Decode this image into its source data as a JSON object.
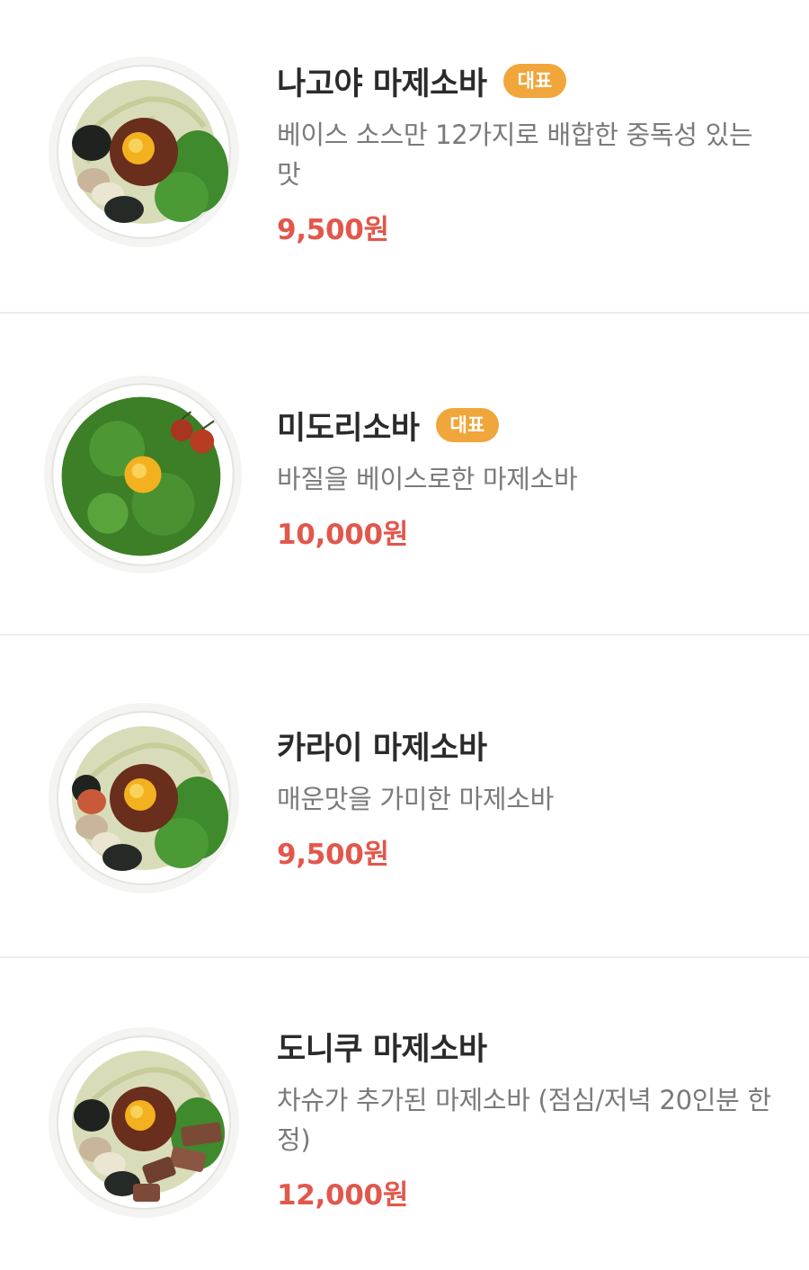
{
  "menu": {
    "items": [
      {
        "name": "나고야 마제소바",
        "badge": "대표",
        "description": "베이스 소스만 12가지로 배합한 중독성 있는 맛",
        "price": "9,500원",
        "image": "mazesoba-bowl-image"
      },
      {
        "name": "미도리소바",
        "badge": "대표",
        "description": "바질을 베이스로한 마제소바",
        "price": "10,000원",
        "image": "midori-soba-bowl-image"
      },
      {
        "name": "카라이 마제소바",
        "description": "매운맛을 가미한 마제소바",
        "price": "9,500원",
        "image": "karai-mazesoba-bowl-image"
      },
      {
        "name": "도니쿠 마제소바",
        "description": "차슈가 추가된 마제소바 (점심/저녁 20인분 한정)",
        "price": "12,000원",
        "image": "doniku-mazesoba-bowl-image"
      }
    ]
  },
  "colors": {
    "badge": "#f0a63a",
    "price": "#e2574c",
    "title": "#2b2b2b",
    "description": "#7a7a7a",
    "divider": "#ececec"
  }
}
